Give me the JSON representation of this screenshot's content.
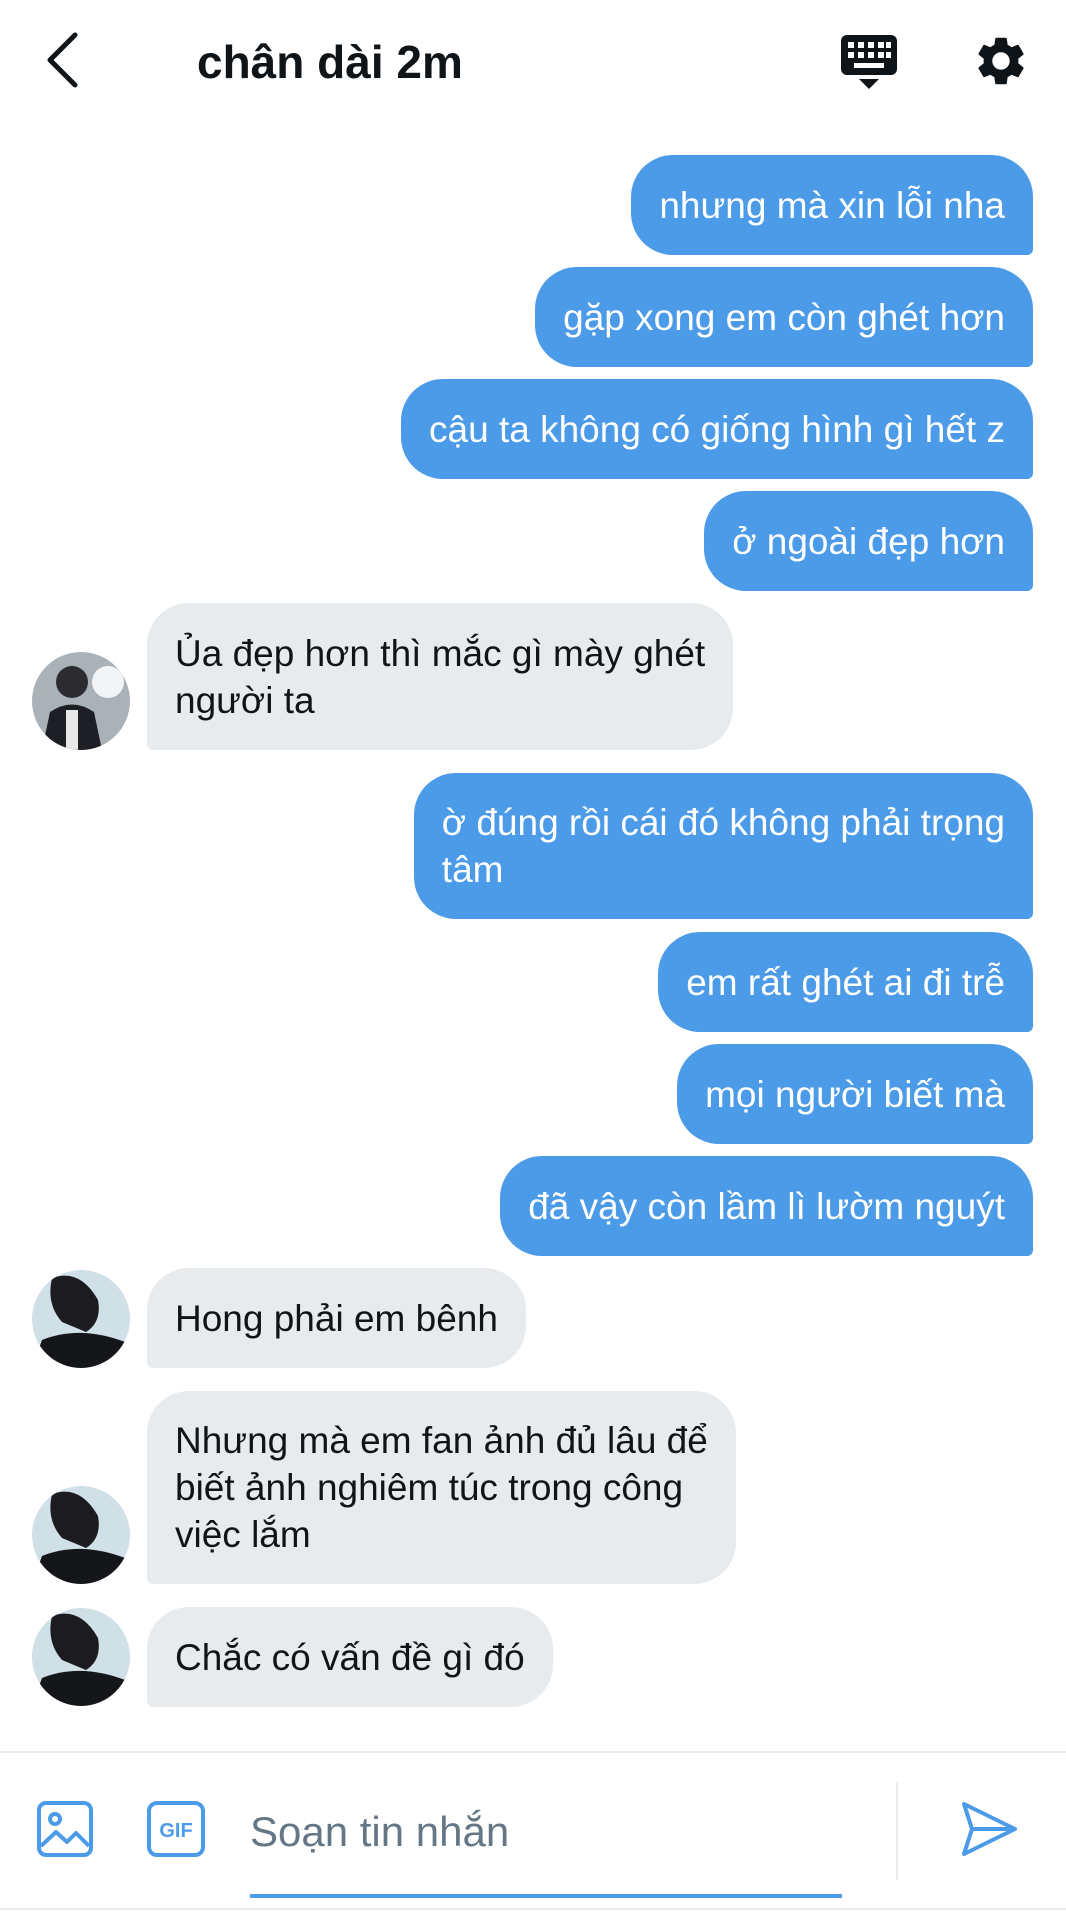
{
  "header": {
    "title": "chân dài 2m"
  },
  "colors": {
    "accent": "#4c9be8",
    "incoming_bubble": "#e8ebee",
    "text": "#0f1419",
    "placeholder": "#657786"
  },
  "icons": {
    "back": "chevron-left-icon",
    "keyboard": "keyboard-icon",
    "settings": "gear-icon",
    "image": "image-icon",
    "gif": "gif-icon",
    "send": "send-icon"
  },
  "messages": [
    {
      "direction": "out",
      "text": "nhưng mà xin lỗi nha"
    },
    {
      "direction": "out",
      "text": "gặp xong em còn ghét hơn"
    },
    {
      "direction": "out",
      "text": "cậu ta không có giống hình gì hết z"
    },
    {
      "direction": "out",
      "text": "ở ngoài đẹp hơn"
    },
    {
      "direction": "in",
      "text": "Ủa đẹp hơn thì mắc gì mày ghét\nngười ta"
    },
    {
      "direction": "out",
      "text": "ờ đúng rồi cái đó không phải trọng\ntâm"
    },
    {
      "direction": "out",
      "text": "em rất ghét ai đi trễ"
    },
    {
      "direction": "out",
      "text": "mọi người biết mà"
    },
    {
      "direction": "out",
      "text": "đã vậy còn lầm lì lườm nguýt"
    },
    {
      "direction": "in",
      "text": "Hong phải em bênh"
    },
    {
      "direction": "in",
      "text": "Nhưng mà em fan ảnh đủ lâu để\nbiết ảnh nghiêm túc trong công\nviệc lắm"
    },
    {
      "direction": "in",
      "text": "Chắc có vấn đề gì đó"
    }
  ],
  "composer": {
    "placeholder": "Soạn tin nhắn",
    "gif_label": "GIF"
  }
}
